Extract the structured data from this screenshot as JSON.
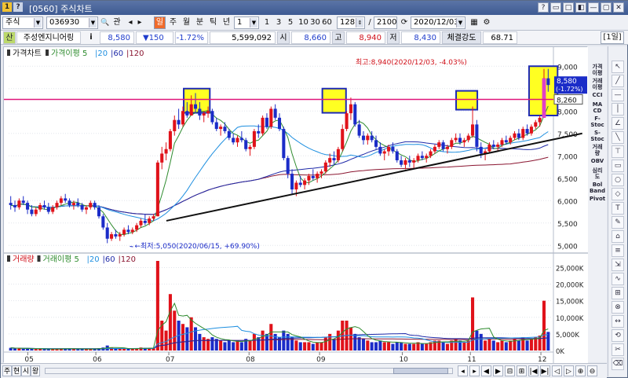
{
  "window": {
    "code": "[0560]",
    "title": "주식차트",
    "right_buttons": [
      "?",
      "▭",
      "□",
      "◧",
      "—",
      "▢",
      "✕"
    ]
  },
  "toolbar": {
    "market": "주식",
    "stock_code": "036930",
    "btn_gwan": "관",
    "period_buttons": [
      "일",
      "주",
      "월",
      "분",
      "틱",
      "년"
    ],
    "interval_value": "1",
    "interval_buttons": [
      "1",
      "3",
      "5",
      "10",
      "30",
      "60"
    ],
    "count": "128",
    "total": "2100",
    "date": "2020/12/03"
  },
  "quote": {
    "name": "주성엔지니어링",
    "info_icon": "i",
    "price": "8,580",
    "change": "▼150",
    "change_pct": "-1.72%",
    "volume": "5,599,092",
    "label_open": "시",
    "open": "8,660",
    "label_high": "고",
    "high": "8,940",
    "label_low": "저",
    "low": "8,430",
    "label_strength": "체결강도",
    "strength": "68.71",
    "period_badge": "[1일]"
  },
  "price_legend": {
    "title": "가격차트",
    "ma_label": "가격이평",
    "ma_periods": [
      "5",
      "20",
      "60",
      "120"
    ],
    "colors": {
      "ma5": "#2e8b2e",
      "ma20": "#1e8fe0",
      "ma60": "#1f2aa8",
      "ma120": "#8a1530"
    }
  },
  "volume_legend": {
    "title": "거래량",
    "ma_label": "거래이평",
    "ma_periods": [
      "5",
      "20",
      "60",
      "120"
    ]
  },
  "annotations": {
    "max": "최고:8,940(2020/12/03, -4.03%)",
    "min": "최저:5,050(2020/06/15, +69.90%)",
    "price_tag": "8,580",
    "price_tag_pct": "(-1.72%)",
    "line_tag": "8,260"
  },
  "chart_data": {
    "type": "candlestick",
    "price_axis": {
      "ticks": [
        "9,000",
        "8,500",
        "8,000",
        "7,500",
        "7,000",
        "6,500",
        "6,000",
        "5,500",
        "5,000"
      ],
      "range": [
        4900,
        9250
      ]
    },
    "volume_axis": {
      "ticks": [
        "25,000K",
        "20,000K",
        "15,000K",
        "10,000K",
        "5,000K",
        "0K"
      ],
      "range": [
        0,
        27000
      ]
    },
    "x_ticks": [
      "05",
      "06",
      "07",
      "08",
      "09",
      "10",
      "11",
      "12"
    ],
    "horizontal_line": 8260,
    "trendline": {
      "from": {
        "date": "2020/06/30",
        "price": 5550
      },
      "to": {
        "date": "2020/12/18",
        "price": 7500
      }
    },
    "highlight_boxes": [
      {
        "from": "2020/07/08",
        "to": "2020/07/17",
        "price_low": 7960,
        "price_high": 8500
      },
      {
        "from": "2020/09/03",
        "to": "2020/09/11",
        "price_low": 7960,
        "price_high": 8500
      },
      {
        "from": "2020/10/28",
        "to": "2020/11/04",
        "price_low": 8030,
        "price_high": 8450
      },
      {
        "from": "2020/11/27",
        "to": "2020/12/07",
        "price_low": 7900,
        "price_high": 9000
      }
    ],
    "candles": [
      [
        5950,
        6100,
        5800,
        5900,
        800
      ],
      [
        5900,
        6000,
        5750,
        5850,
        600
      ],
      [
        5850,
        6050,
        5800,
        6000,
        700
      ],
      [
        6000,
        6100,
        5900,
        5950,
        500
      ],
      [
        5950,
        6000,
        5700,
        5800,
        600
      ],
      [
        5800,
        5900,
        5650,
        5700,
        500
      ],
      [
        5700,
        5850,
        5650,
        5800,
        450
      ],
      [
        5800,
        5950,
        5750,
        5900,
        500
      ],
      [
        5900,
        6000,
        5800,
        5850,
        400
      ],
      [
        5850,
        5950,
        5700,
        5750,
        450
      ],
      [
        5750,
        5900,
        5700,
        5850,
        400
      ],
      [
        5850,
        6000,
        5800,
        5950,
        500
      ],
      [
        5950,
        6100,
        5900,
        6050,
        600
      ],
      [
        6050,
        6150,
        5950,
        6000,
        550
      ],
      [
        6000,
        6050,
        5850,
        5900,
        500
      ],
      [
        5900,
        6000,
        5800,
        5950,
        400
      ],
      [
        5950,
        6050,
        5850,
        5900,
        450
      ],
      [
        5900,
        5950,
        5750,
        5800,
        500
      ],
      [
        5800,
        5900,
        5700,
        5850,
        400
      ],
      [
        5850,
        6000,
        5800,
        5950,
        500
      ],
      [
        5950,
        6000,
        5800,
        5850,
        450
      ],
      [
        5850,
        5900,
        5600,
        5650,
        700
      ],
      [
        5650,
        5700,
        5350,
        5400,
        900
      ],
      [
        5400,
        5500,
        5050,
        5150,
        1500
      ],
      [
        5150,
        5300,
        5100,
        5250,
        800
      ],
      [
        5250,
        5350,
        5150,
        5200,
        600
      ],
      [
        5200,
        5300,
        5100,
        5250,
        500
      ],
      [
        5250,
        5400,
        5200,
        5350,
        600
      ],
      [
        5350,
        5450,
        5250,
        5300,
        500
      ],
      [
        5300,
        5400,
        5250,
        5350,
        450
      ],
      [
        5350,
        5500,
        5300,
        5450,
        700
      ],
      [
        5450,
        5600,
        5400,
        5550,
        900
      ],
      [
        5550,
        5700,
        5450,
        5500,
        800
      ],
      [
        5500,
        5650,
        5450,
        5600,
        700
      ],
      [
        5600,
        5700,
        5550,
        5650,
        600
      ],
      [
        5650,
        6900,
        5650,
        6850,
        27000
      ],
      [
        6850,
        7200,
        6700,
        7050,
        9000
      ],
      [
        7050,
        7300,
        6900,
        7150,
        6000
      ],
      [
        7150,
        7600,
        7100,
        7550,
        17000
      ],
      [
        7550,
        7900,
        7450,
        7800,
        12000
      ],
      [
        7800,
        8050,
        7600,
        7700,
        9000
      ],
      [
        7700,
        8100,
        7650,
        8000,
        8000
      ],
      [
        8000,
        8200,
        7850,
        7900,
        7000
      ],
      [
        7900,
        8350,
        7900,
        8150,
        10000
      ],
      [
        8150,
        8400,
        7950,
        8050,
        7000
      ],
      [
        8050,
        8200,
        7800,
        7900,
        5000
      ],
      [
        7900,
        8000,
        7750,
        7950,
        4000
      ],
      [
        7950,
        8100,
        7850,
        8000,
        3500
      ],
      [
        8000,
        8050,
        7700,
        7750,
        4000
      ],
      [
        7750,
        7850,
        7550,
        7600,
        3500
      ],
      [
        7600,
        7700,
        7450,
        7650,
        3000
      ],
      [
        7650,
        7750,
        7500,
        7550,
        2500
      ],
      [
        7550,
        7600,
        7350,
        7400,
        3000
      ],
      [
        7400,
        7500,
        7250,
        7300,
        2500
      ],
      [
        7300,
        7450,
        7200,
        7400,
        3000
      ],
      [
        7400,
        7550,
        7300,
        7350,
        2500
      ],
      [
        7350,
        7400,
        7100,
        7150,
        3500
      ],
      [
        7150,
        7250,
        7000,
        7200,
        3000
      ],
      [
        7200,
        7600,
        7150,
        7550,
        5000
      ],
      [
        7550,
        7700,
        7400,
        7500,
        4000
      ],
      [
        7500,
        7900,
        7450,
        7850,
        6000
      ],
      [
        7850,
        7950,
        7600,
        7650,
        5000
      ],
      [
        7650,
        8100,
        7600,
        8050,
        8000
      ],
      [
        8050,
        8150,
        7800,
        7850,
        5000
      ],
      [
        7850,
        7950,
        7550,
        7600,
        4000
      ],
      [
        7600,
        7650,
        6900,
        6950,
        6000
      ],
      [
        6950,
        7000,
        6500,
        6600,
        5000
      ],
      [
        6600,
        6700,
        6150,
        6250,
        4000
      ],
      [
        6250,
        6450,
        6100,
        6400,
        3000
      ],
      [
        6400,
        6550,
        6300,
        6350,
        2500
      ],
      [
        6350,
        6500,
        6250,
        6450,
        2500
      ],
      [
        6450,
        6600,
        6350,
        6550,
        2500
      ],
      [
        6550,
        6700,
        6450,
        6500,
        2000
      ],
      [
        6500,
        6650,
        6400,
        6600,
        2500
      ],
      [
        6600,
        6700,
        6500,
        6650,
        2500
      ],
      [
        6650,
        6900,
        6600,
        6850,
        4000
      ],
      [
        6850,
        7050,
        6750,
        6950,
        5000
      ],
      [
        6950,
        7100,
        6800,
        6900,
        3500
      ],
      [
        6900,
        7200,
        6850,
        7150,
        6000
      ],
      [
        7150,
        7700,
        7100,
        7600,
        9000
      ],
      [
        7600,
        8000,
        7550,
        7950,
        9000
      ],
      [
        7950,
        8300,
        7800,
        8150,
        7000
      ],
      [
        8150,
        8200,
        7650,
        7700,
        5000
      ],
      [
        7700,
        7800,
        7400,
        7450,
        4000
      ],
      [
        7450,
        7550,
        7250,
        7350,
        3500
      ],
      [
        7350,
        7500,
        7250,
        7450,
        3000
      ],
      [
        7450,
        7550,
        7300,
        7350,
        2500
      ],
      [
        7350,
        7450,
        7150,
        7200,
        2500
      ],
      [
        7200,
        7300,
        7000,
        7050,
        3000
      ],
      [
        7050,
        7150,
        6900,
        7100,
        2500
      ],
      [
        7100,
        7250,
        7000,
        7200,
        2500
      ],
      [
        7200,
        7300,
        7050,
        7100,
        2000
      ],
      [
        7100,
        7150,
        6850,
        6900,
        2500
      ],
      [
        6900,
        7000,
        6750,
        6800,
        2500
      ],
      [
        6800,
        6950,
        6700,
        6900,
        2000
      ],
      [
        6900,
        7000,
        6750,
        6850,
        2000
      ],
      [
        6850,
        6950,
        6700,
        6900,
        2000
      ],
      [
        6900,
        7050,
        6850,
        7000,
        2500
      ],
      [
        7000,
        7100,
        6900,
        6950,
        2000
      ],
      [
        6950,
        7050,
        6850,
        7000,
        2000
      ],
      [
        7000,
        7150,
        6950,
        7100,
        2500
      ],
      [
        7100,
        7250,
        7050,
        7200,
        3000
      ],
      [
        7200,
        7350,
        7150,
        7300,
        3000
      ],
      [
        7300,
        7350,
        7100,
        7150,
        2500
      ],
      [
        7150,
        7250,
        7050,
        7200,
        2000
      ],
      [
        7200,
        7400,
        7150,
        7350,
        3000
      ],
      [
        7350,
        7500,
        7300,
        7400,
        3500
      ],
      [
        7400,
        7500,
        7250,
        7300,
        3000
      ],
      [
        7300,
        7400,
        7200,
        7350,
        2500
      ],
      [
        7350,
        7500,
        7300,
        7450,
        3000
      ],
      [
        7450,
        8100,
        7400,
        7700,
        16000
      ],
      [
        7700,
        7800,
        7100,
        7200,
        6000
      ],
      [
        7200,
        7300,
        6950,
        7050,
        5000
      ],
      [
        7050,
        7150,
        6900,
        7100,
        3000
      ],
      [
        7100,
        7300,
        7050,
        7250,
        3500
      ],
      [
        7250,
        7350,
        7150,
        7200,
        3000
      ],
      [
        7200,
        7300,
        7100,
        7250,
        2500
      ],
      [
        7250,
        7400,
        7200,
        7350,
        3000
      ],
      [
        7350,
        7450,
        7250,
        7300,
        2500
      ],
      [
        7300,
        7450,
        7250,
        7400,
        3000
      ],
      [
        7400,
        7550,
        7350,
        7500,
        3500
      ],
      [
        7500,
        7600,
        7350,
        7400,
        3000
      ],
      [
        7400,
        7650,
        7350,
        7600,
        4000
      ],
      [
        7600,
        7700,
        7450,
        7500,
        3000
      ],
      [
        7500,
        7700,
        7450,
        7650,
        3500
      ],
      [
        7650,
        7800,
        7600,
        7750,
        4000
      ],
      [
        7750,
        7900,
        7650,
        7850,
        4500
      ],
      [
        7850,
        8940,
        7850,
        8730,
        15000
      ],
      [
        8730,
        8940,
        8430,
        8580,
        5600
      ]
    ]
  }
}
